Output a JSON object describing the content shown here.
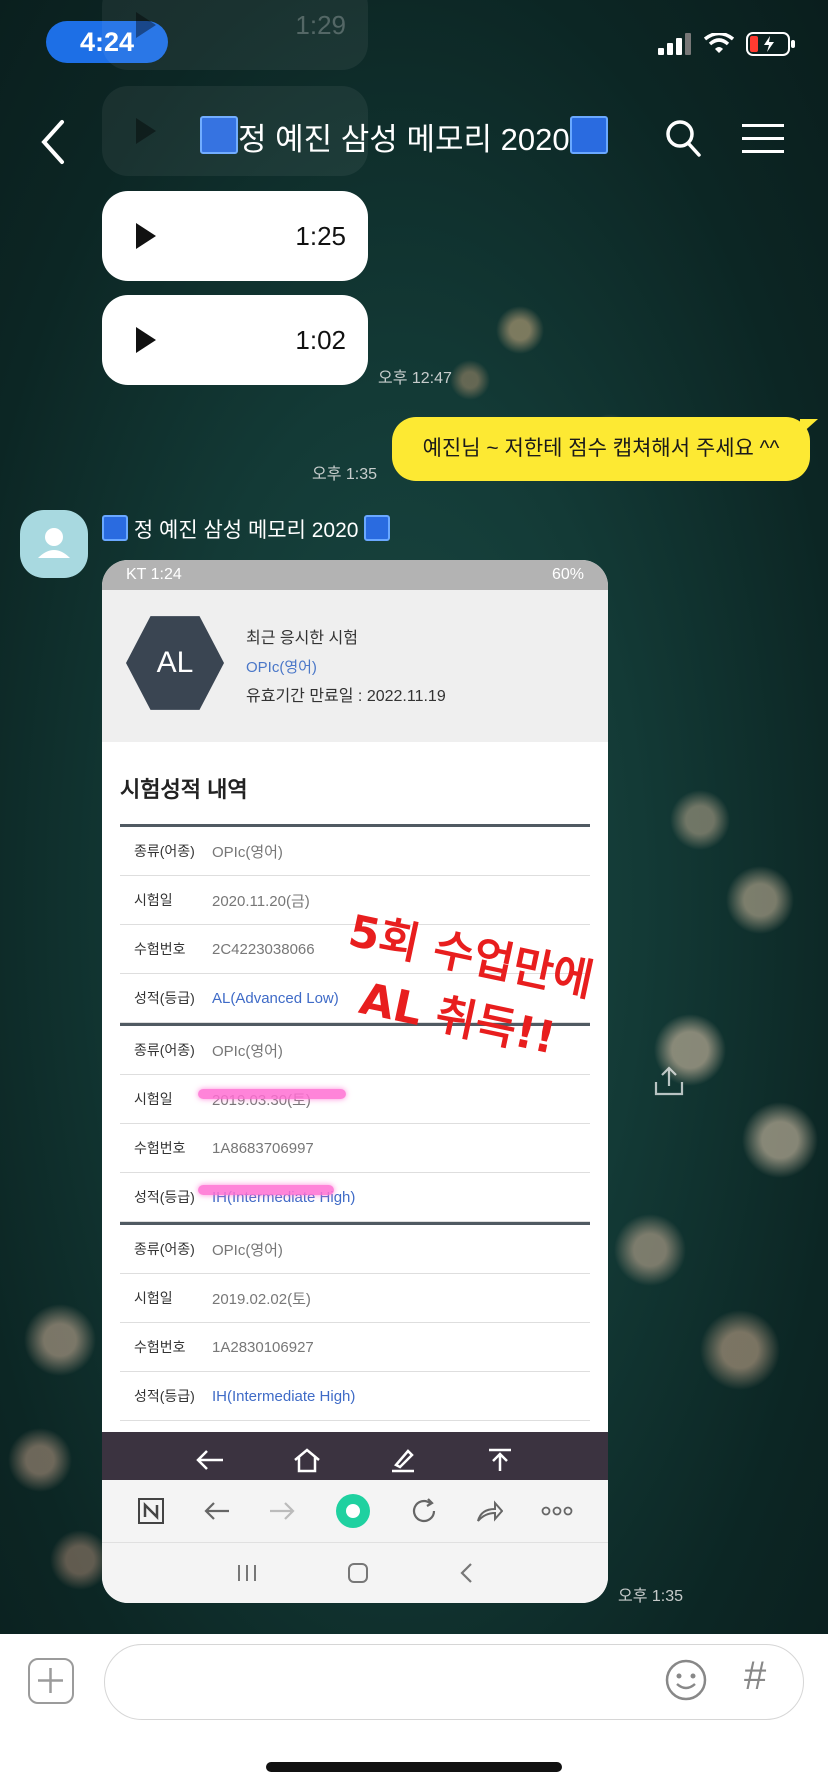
{
  "status_bar": {
    "time": "4:24"
  },
  "header": {
    "title": "정 예진 삼성 메모리 2020"
  },
  "voice_messages": [
    {
      "duration": "1:29"
    },
    {
      "duration": ""
    },
    {
      "duration": "1:25"
    },
    {
      "duration": "1:02"
    }
  ],
  "timestamps": {
    "voice": "오후 12:47",
    "my_message": "오후 1:35",
    "image": "오후 1:35"
  },
  "my_message": "예진님 ~ 저한테 점수 캡쳐해서 주세요 ^^",
  "sender": {
    "name": "정 예진 삼성 메모리 2020"
  },
  "screenshot": {
    "phone_status_left": "KT 1:24",
    "phone_status_right": "60%",
    "badge": "AL",
    "recent_title": "최근 응시한 시험",
    "recent_lang": "OPIc(영어)",
    "expiry": "유효기간 만료일 : 2022.11.19",
    "section_title": "시험성적 내역",
    "stamp_line1": "5회 수업만에",
    "stamp_line2": "AL 취득!!",
    "records": [
      {
        "type_label": "종류(어종)",
        "type": "OPIc(영어)",
        "date_label": "시험일",
        "date": "2020.11.20(금)",
        "num_label": "수험번호",
        "num": "2C4223038066",
        "grade_label": "성적(등급)",
        "grade": "AL(Advanced Low)"
      },
      {
        "type_label": "종류(어종)",
        "type": "OPIc(영어)",
        "date_label": "시험일",
        "date": "2019.03.30(토)",
        "num_label": "수험번호",
        "num": "1A8683706997",
        "grade_label": "성적(등급)",
        "grade": "IH(Intermediate High)"
      },
      {
        "type_label": "종류(어종)",
        "type": "OPIc(영어)",
        "date_label": "시험일",
        "date": "2019.02.02(토)",
        "num_label": "수험번호",
        "num": "1A2830106927",
        "grade_label": "성적(등급)",
        "grade": "IH(Intermediate High)"
      }
    ]
  },
  "input_bar": {
    "hash": "#"
  },
  "colors": {
    "my_bubble": "#fde933",
    "time_pill": "#1d6fe6",
    "stamp": "#e81e1e",
    "grade": "#3f6bc7",
    "highlight": "#ff6ed2"
  },
  "icons": [
    "back-icon",
    "search-icon",
    "menu-icon",
    "play-icon",
    "share-icon",
    "plus-icon",
    "emoji-icon"
  ]
}
